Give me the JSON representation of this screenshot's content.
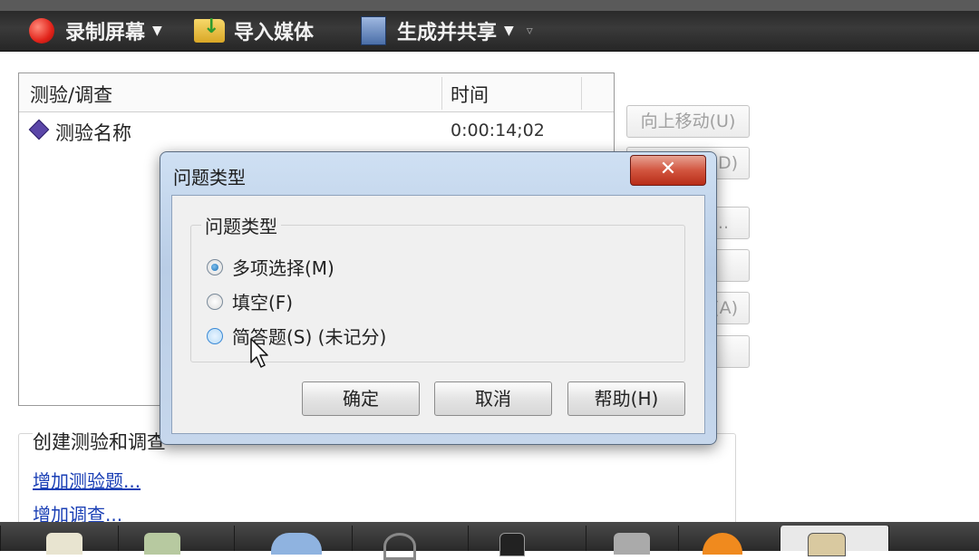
{
  "toolbar": {
    "record_label": "录制屏幕",
    "import_label": "导入媒体",
    "share_label": "生成并共享"
  },
  "quiz_list": {
    "col_name": "测验/调查",
    "col_time": "时间",
    "rows": [
      {
        "name": "测验名称",
        "time": "0:00:14;02"
      }
    ]
  },
  "side_buttons": {
    "move_up": "向上移动(U)",
    "move_down_partial": "(D)",
    "edit_partial": "...",
    "add_partial": "(A)"
  },
  "create_section": {
    "title": "创建测验和调查",
    "add_quiz": "增加测验题...",
    "add_survey": "增加调查..."
  },
  "dialog": {
    "title": "问题类型",
    "close_glyph": "✕",
    "group_title": "问题类型",
    "options": [
      {
        "label": "多项选择(M)",
        "checked": true
      },
      {
        "label": "填空(F)",
        "checked": false
      },
      {
        "label": "简答题(S) (未记分)",
        "checked": false
      }
    ],
    "ok_label": "确定",
    "cancel_label": "取消",
    "help_label": "帮助(H)"
  },
  "icons": {
    "record": "record-icon",
    "import": "folder-import-icon",
    "share": "share-icon",
    "quiz_item": "diamond-icon",
    "cursor": "mouse-cursor-icon"
  },
  "colors": {
    "link": "#1a3fb5",
    "close_button": "#c9432c",
    "dialog_frame": "#c6d7ec"
  }
}
